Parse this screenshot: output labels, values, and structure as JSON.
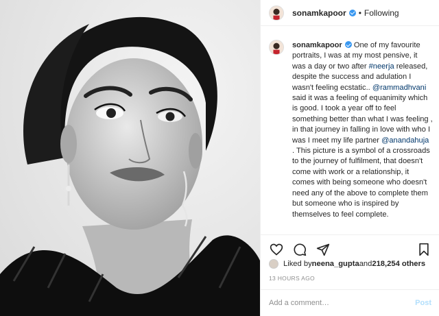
{
  "post": {
    "username": "sonamkapoor",
    "separator": "•",
    "follow_status": "Following"
  },
  "caption": {
    "username": "sonamkapoor",
    "part1": " One of my favourite portraits, I was at my most pensive, it was a day or two after ",
    "hashtag": "#neerja",
    "part2": " released, despite the success and adulation I wasn't feeling ecstatic.. ",
    "mention1": "@rammadhvani",
    "part3": " said it was a feeling of equanimity which is good. I took a year off to feel something better than what I was feeling , in that journey in falling in love with who I was I meet my life partner ",
    "mention2": "@anandahuja",
    "part4": " . This picture is a symbol of a crossroads to the journey of fulfilment, that doesn't come with work or a relationship, it comes with being someone who doesn't need any of the above to complete them but someone who is inspired by themselves to feel complete."
  },
  "actions": {
    "icons": [
      "heart-icon",
      "comment-icon",
      "share-icon",
      "bookmark-icon"
    ]
  },
  "likes": {
    "prefix": "Liked by ",
    "user": "neena_gupta",
    "middle": " and ",
    "count": "218,254 others"
  },
  "timestamp": "13 HOURS AGO",
  "comment": {
    "placeholder": "Add a comment…",
    "post_label": "Post"
  },
  "colors": {
    "accent": "#3897f0",
    "link": "#00376b",
    "post_disabled": "#b2dffc",
    "muted": "#8e8e8e"
  }
}
